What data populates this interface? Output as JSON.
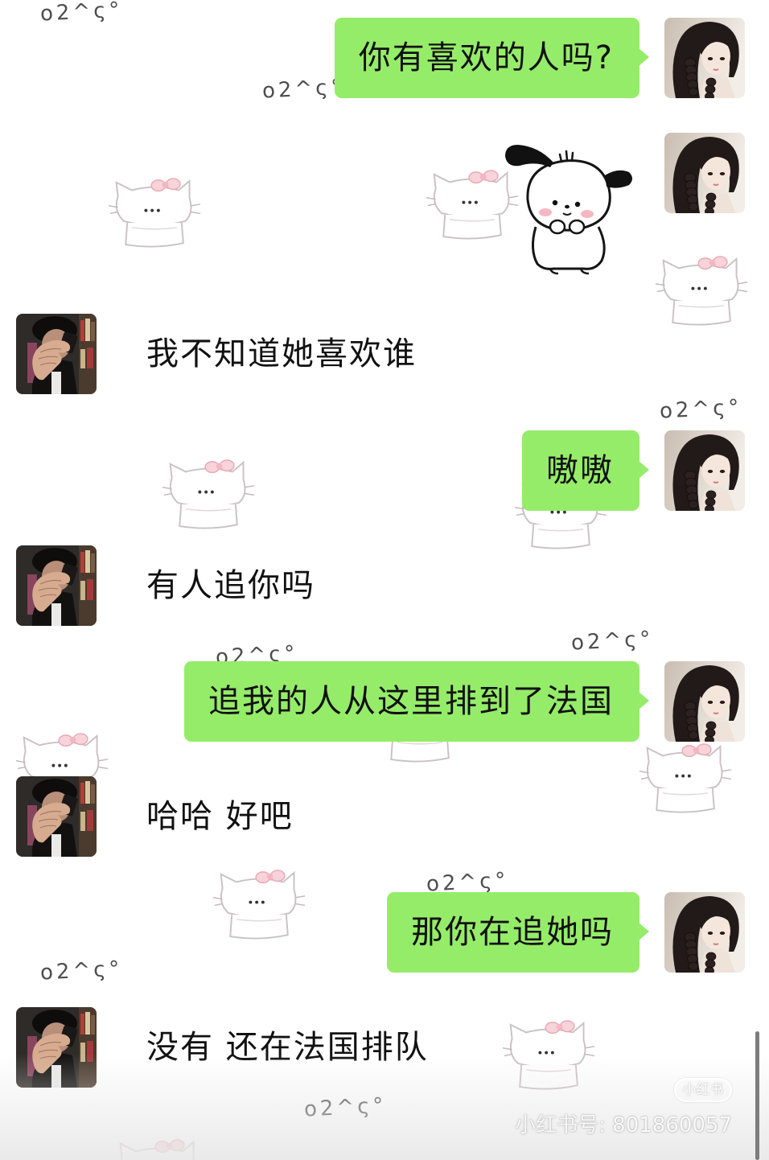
{
  "colors": {
    "background": "#FFFFFF",
    "bubble_green": "#95EC69",
    "text": "#111111",
    "doodle_pink": "#F6C6D0"
  },
  "messages": [
    {
      "side": "right",
      "type": "text",
      "text": "你有喜欢的人吗?",
      "avatar": "girl-avatar"
    },
    {
      "side": "right",
      "type": "sticker",
      "sticker": "pochacco-sticker",
      "avatar": "girl-avatar"
    },
    {
      "side": "left",
      "type": "text",
      "text": "我不知道她喜欢谁",
      "avatar": "boy-avatar"
    },
    {
      "side": "right",
      "type": "text",
      "text": "嗷嗷",
      "avatar": "girl-avatar"
    },
    {
      "side": "left",
      "type": "text",
      "text": "有人追你吗",
      "avatar": "boy-avatar"
    },
    {
      "side": "right",
      "type": "text",
      "text": "追我的人从这里排到了法国",
      "avatar": "girl-avatar"
    },
    {
      "side": "left",
      "type": "text",
      "text": "哈哈 好吧",
      "avatar": "boy-avatar"
    },
    {
      "side": "right",
      "type": "text",
      "text": "那你在追她吗",
      "avatar": "girl-avatar"
    },
    {
      "side": "left",
      "type": "text",
      "text": "没有 还在法国排队",
      "avatar": "boy-avatar"
    }
  ],
  "decor": {
    "doodle_text": "o2^ς°",
    "doodle_icon": "hello-kitty-doodle"
  },
  "watermark": {
    "logo_text": "小红书",
    "id_text": "小红书号: 801860057"
  }
}
